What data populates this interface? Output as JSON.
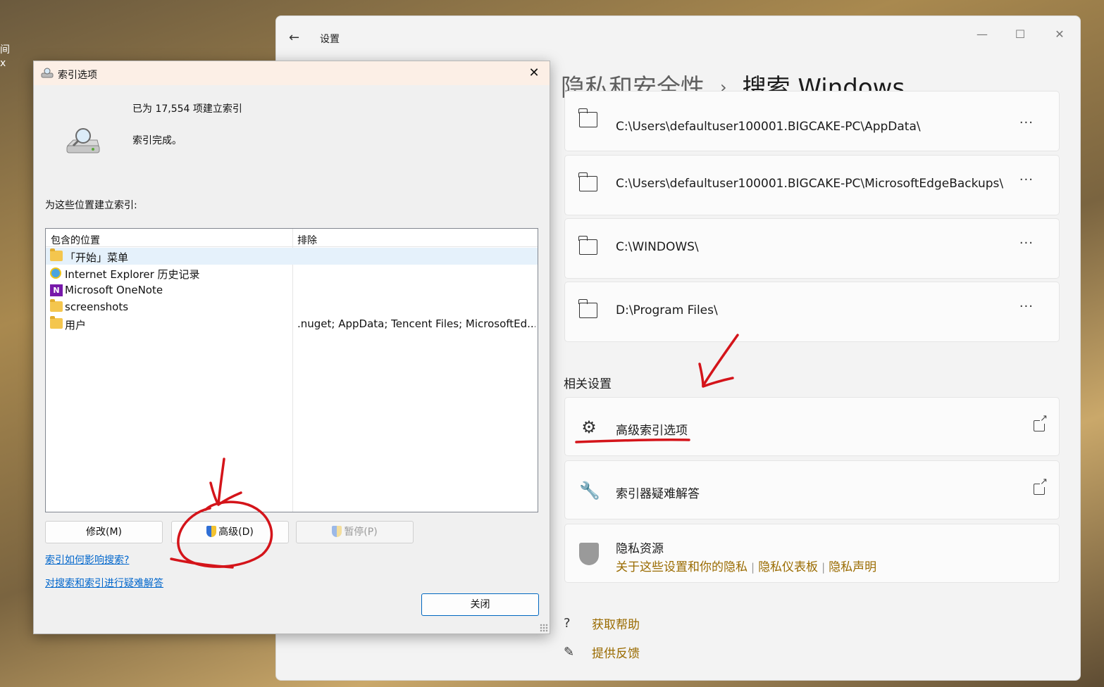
{
  "desktop": {
    "text1": "间",
    "text2": "x"
  },
  "settings": {
    "app_title": "设置",
    "window_controls": {
      "minimize": "—",
      "maximize": "☐",
      "close": "✕"
    },
    "breadcrumb": {
      "parent": "隐私和安全性",
      "separator": "›",
      "current": "搜索 Windows"
    },
    "folders": [
      {
        "path": "C:\\Users\\defaultuser100001.BIGCAKE-PC\\AppData\\",
        "more": "···"
      },
      {
        "path": "C:\\Users\\defaultuser100001.BIGCAKE-PC\\MicrosoftEdgeBackups\\",
        "more": "···"
      },
      {
        "path": "C:\\WINDOWS\\",
        "more": "···"
      },
      {
        "path": "D:\\Program Files\\",
        "more": "···"
      }
    ],
    "related_title": "相关设置",
    "related": [
      {
        "label": "高级索引选项",
        "icon": "gear-icon"
      },
      {
        "label": "索引器疑难解答",
        "icon": "wrench-icon"
      }
    ],
    "privacy": {
      "title": "隐私资源",
      "links": [
        "关于这些设置和你的隐私",
        "隐私仪表板",
        "隐私声明"
      ],
      "pipe": "|"
    },
    "help": {
      "get_help": "获取帮助",
      "feedback": "提供反馈"
    }
  },
  "dialog": {
    "title": "索引选项",
    "close_glyph": "✕",
    "status_count": "已为 17,554 项建立索引",
    "status_done": "索引完成。",
    "locations_label": "为这些位置建立索引:",
    "columns": {
      "included": "包含的位置",
      "excluded": "排除"
    },
    "rows": [
      {
        "name": "「开始」菜单",
        "exclude": "",
        "icon": "folder"
      },
      {
        "name": "Internet Explorer 历史记录",
        "exclude": "",
        "icon": "ie"
      },
      {
        "name": "Microsoft OneNote",
        "exclude": "",
        "icon": "onenote"
      },
      {
        "name": "screenshots",
        "exclude": "",
        "icon": "folder"
      },
      {
        "name": "用户",
        "exclude": ".nuget; AppData; Tencent Files; MicrosoftEd...",
        "icon": "folder"
      }
    ],
    "onenote_letter": "N",
    "buttons": {
      "modify": "修改(M)",
      "advanced": "高级(D)",
      "pause": "暂停(P)",
      "close": "关闭"
    },
    "links": {
      "how": "索引如何影响搜索?",
      "troubleshoot": "对搜索和索引进行疑难解答"
    }
  },
  "colors": {
    "accent_link": "#0066cc",
    "settings_link": "#9a6b00",
    "annotation": "#d4141a"
  }
}
